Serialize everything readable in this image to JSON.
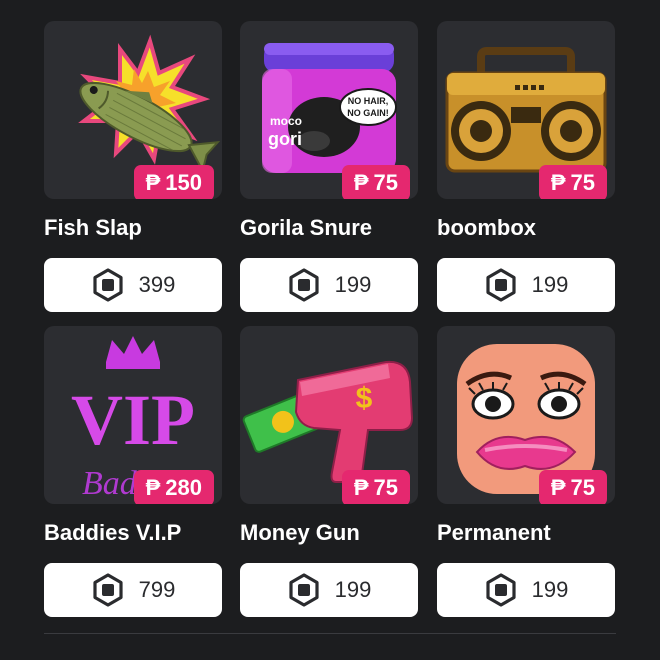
{
  "colors": {
    "background": "#1c1d1f",
    "card": "#2c2d31",
    "badge": "#e5286f",
    "button": "#ffffff"
  },
  "currency_symbol": "₱",
  "items": [
    {
      "name": "Fish Slap",
      "price": "150",
      "robux": "399",
      "icon": "fish-slap-image"
    },
    {
      "name": "Gorila Snure",
      "price": "75",
      "robux": "199",
      "icon": "gorilla-snot-jar-image",
      "jar_text": [
        "moco",
        "gori"
      ],
      "bubble_text": [
        "NO HAIR,",
        "NO GAIN!"
      ]
    },
    {
      "name": "boombox",
      "price": "75",
      "robux": "199",
      "icon": "boombox-image"
    },
    {
      "name": "Baddies V.I.P",
      "price": "280",
      "robux": "799",
      "icon": "vip-crown-image",
      "art_text": [
        "VIP",
        "Baddi"
      ]
    },
    {
      "name": "Money Gun",
      "price": "75",
      "robux": "199",
      "icon": "money-gun-image"
    },
    {
      "name": "Permanent",
      "price": "75",
      "robux": "199",
      "icon": "face-pink-lips-image"
    }
  ]
}
